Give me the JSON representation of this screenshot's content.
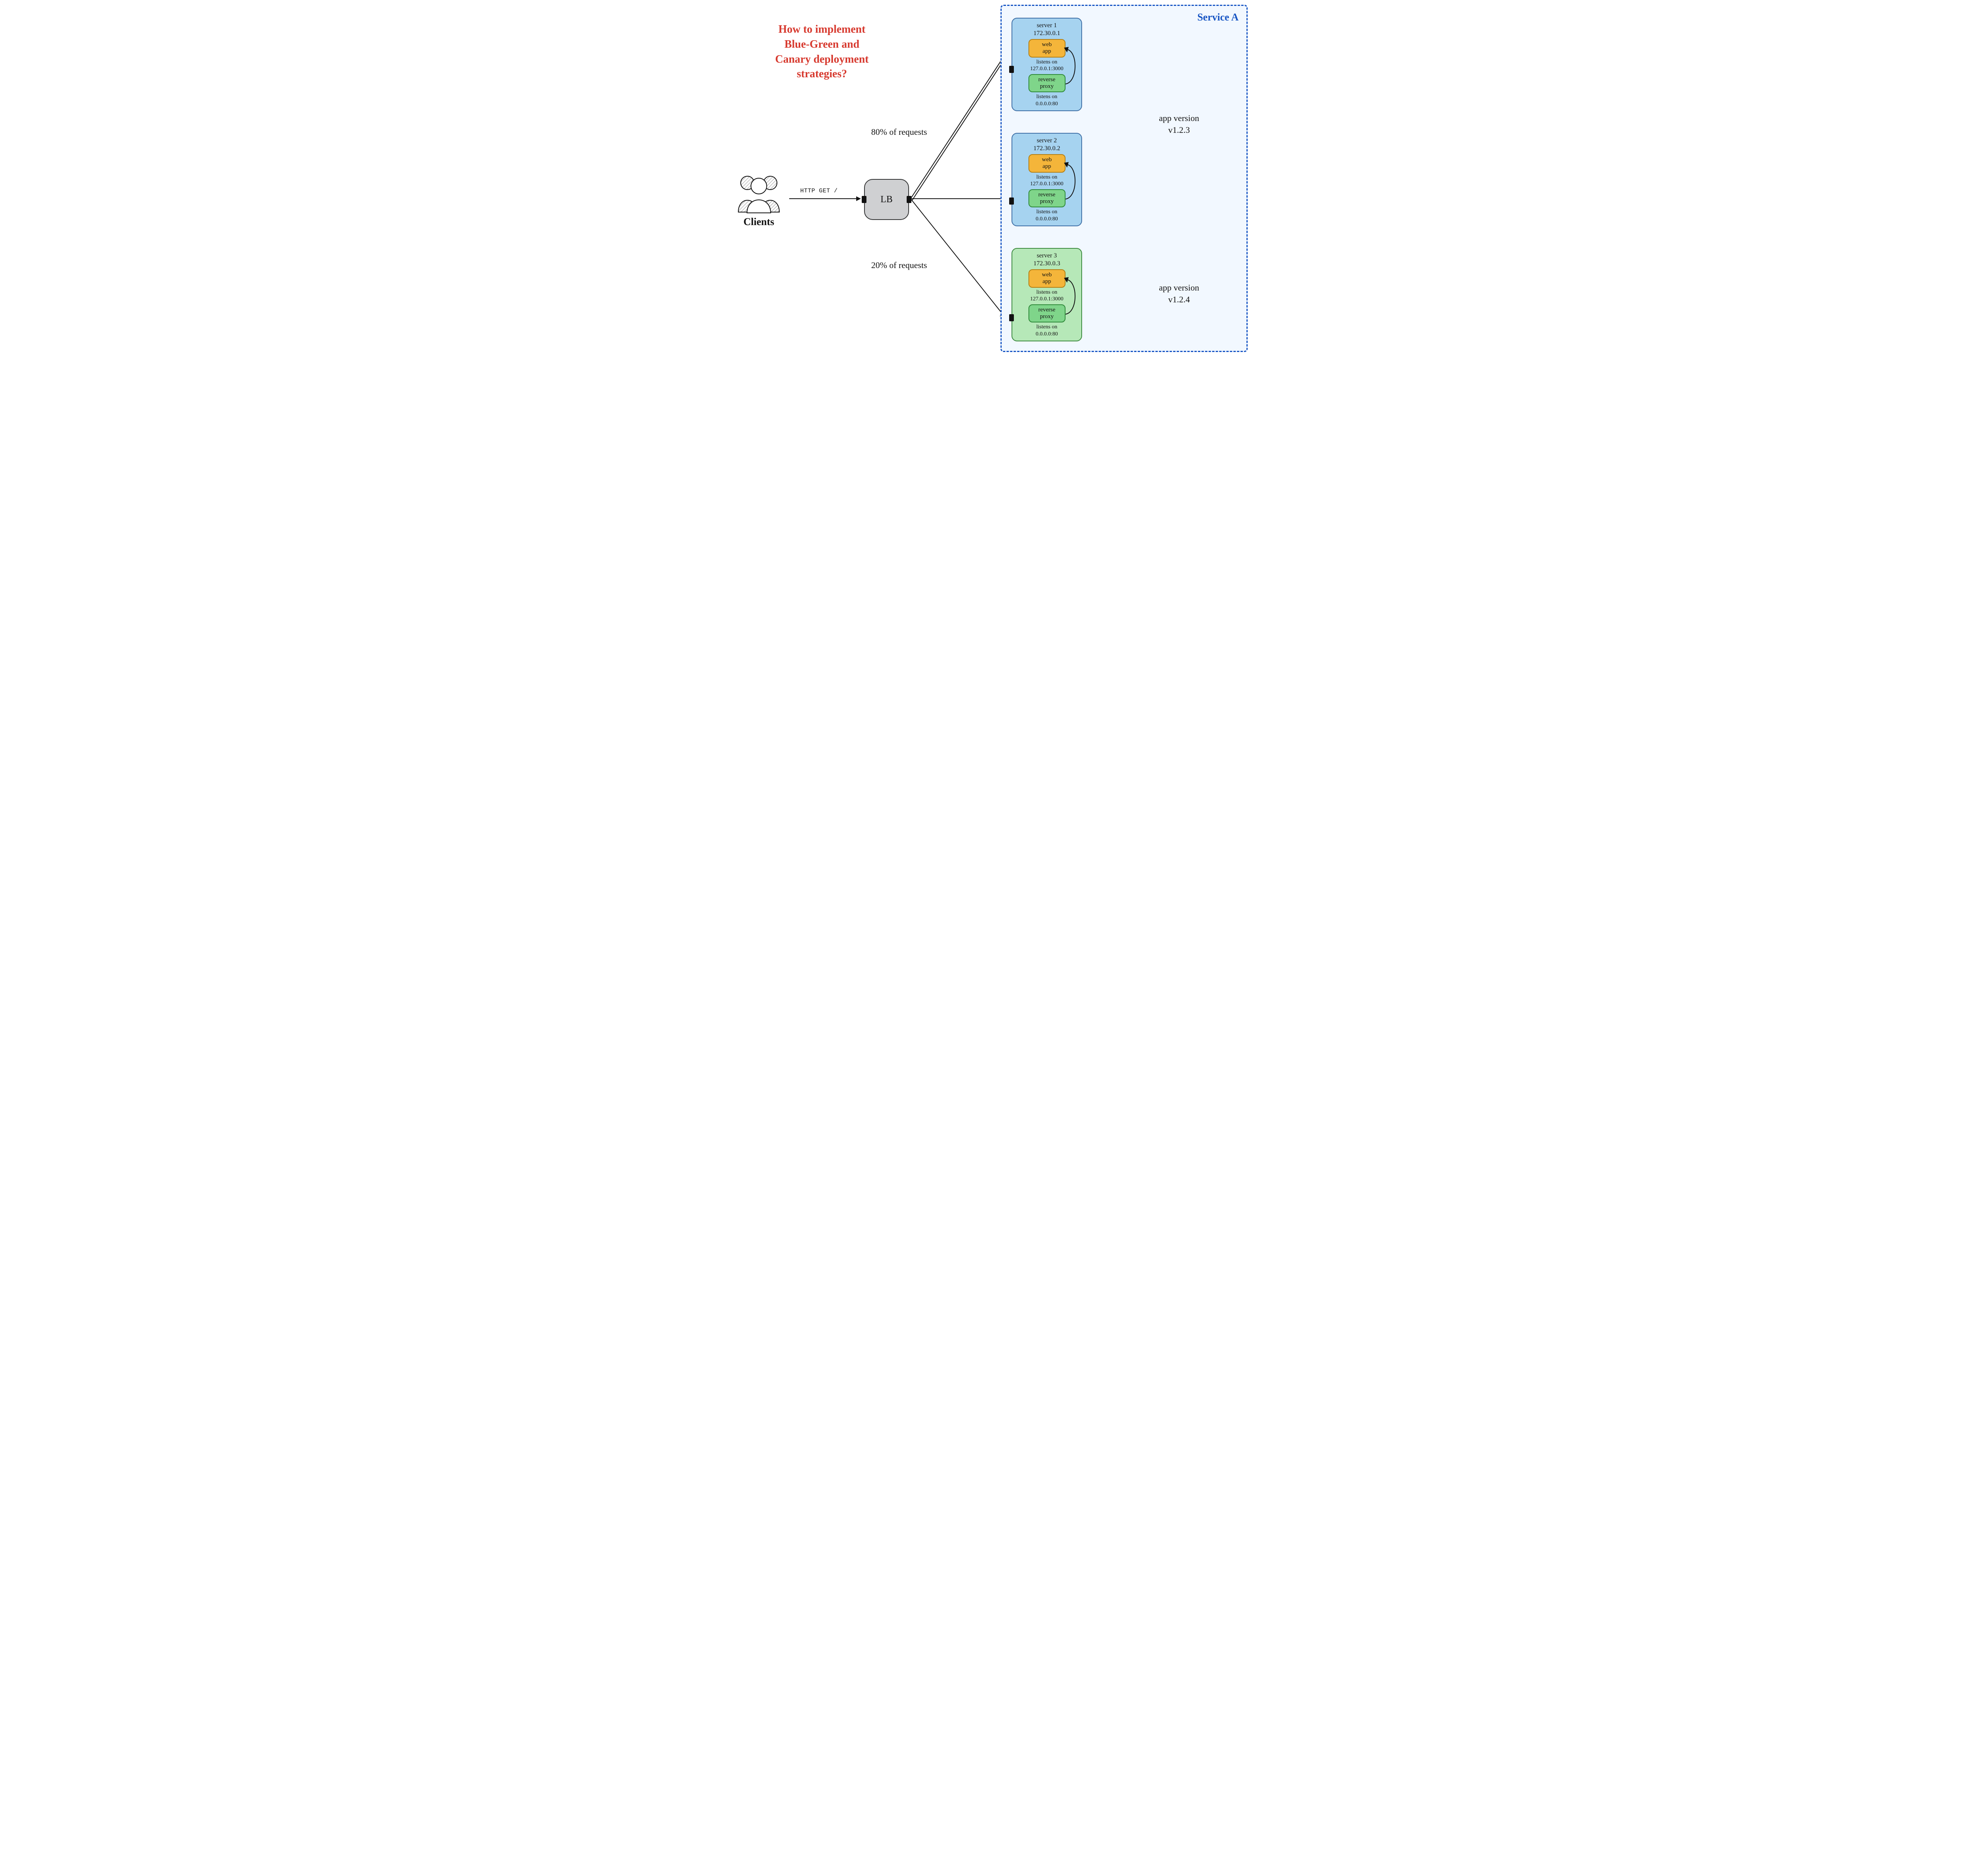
{
  "title": "How to implement\nBlue-Green and\nCanary deployment\nstrategies?",
  "clients_label": "Clients",
  "http_label": "HTTP GET /",
  "lb_label": "LB",
  "pct_top": "80% of requests",
  "pct_bot": "20% of requests",
  "service_name": "Service A",
  "version_top": "app version\nv1.2.3",
  "version_bot": "app version\nv1.2.4",
  "web_app_label": "web\napp",
  "rev_proxy_label": "reverse\nproxy",
  "servers": [
    {
      "name": "server 1",
      "ip": "172.30.0.1",
      "web_listen": "listens on\n127.0.0.1:3000",
      "proxy_listen": "listens on\n0.0.0.0:80",
      "color": "blue"
    },
    {
      "name": "server 2",
      "ip": "172.30.0.2",
      "web_listen": "listens on\n127.0.0.1:3000",
      "proxy_listen": "listens on\n0.0.0.0:80",
      "color": "blue"
    },
    {
      "name": "server 3",
      "ip": "172.30.0.3",
      "web_listen": "listens on\n127.0.0.1:3000",
      "proxy_listen": "listens on\n0.0.0.0:80",
      "color": "green"
    }
  ]
}
